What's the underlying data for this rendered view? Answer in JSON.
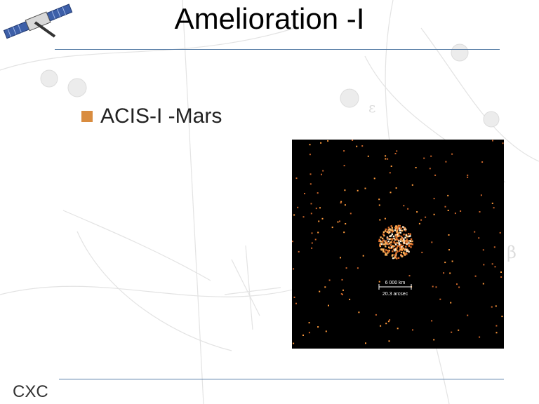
{
  "slide": {
    "title": "Amelioration -I",
    "bullet": "ACIS-I -Mars",
    "footer": "CXC"
  },
  "image": {
    "scale_distance": "6 000 km",
    "scale_angle": "20.3 arcsec"
  },
  "icons": {
    "satellite": "satellite-icon",
    "bullet": "square-bullet-icon"
  },
  "colors": {
    "bullet": "#d98c3f",
    "rule": "#5a7fa8",
    "photon": "#ff9a3c"
  }
}
